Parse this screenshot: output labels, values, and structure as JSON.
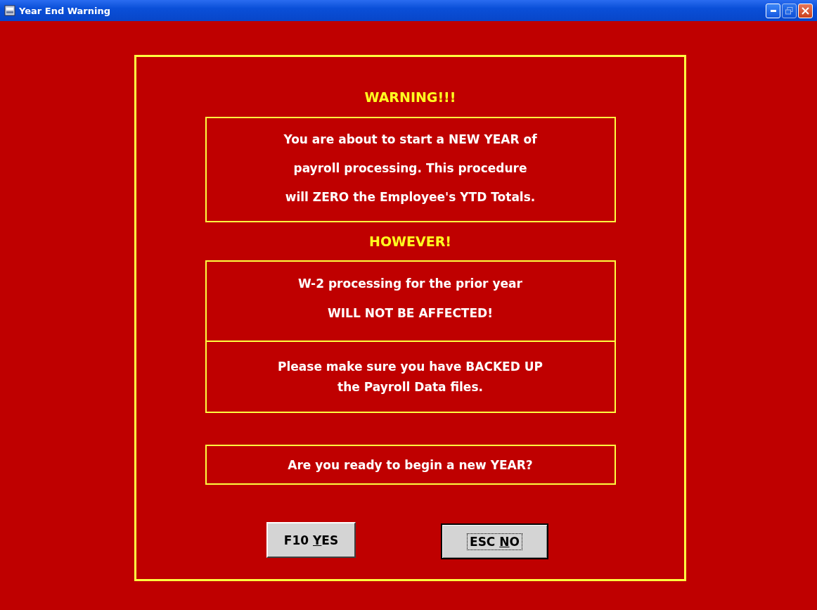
{
  "window": {
    "title": "Year End Warning"
  },
  "heading": "WARNING!!!",
  "notice_box": {
    "lines": [
      "You are about to start a NEW YEAR of",
      "payroll processing. This procedure",
      "will ZERO the Employee's YTD Totals."
    ]
  },
  "subheading": "HOWEVER!",
  "w2_box": {
    "lines": [
      "W-2 processing for the prior year",
      "WILL NOT BE AFFECTED!"
    ]
  },
  "backup_box": {
    "lines": [
      "Please make sure you have BACKED UP",
      "the Payroll Data files."
    ]
  },
  "question_box": {
    "lines": [
      "Are you ready to begin a new YEAR?"
    ]
  },
  "buttons": [
    {
      "label_before": "F10 ",
      "access_key": "Y",
      "label_after": "ES",
      "focused": false
    },
    {
      "label_before": "ESC ",
      "access_key": "N",
      "label_after": "O",
      "focused": true
    }
  ]
}
